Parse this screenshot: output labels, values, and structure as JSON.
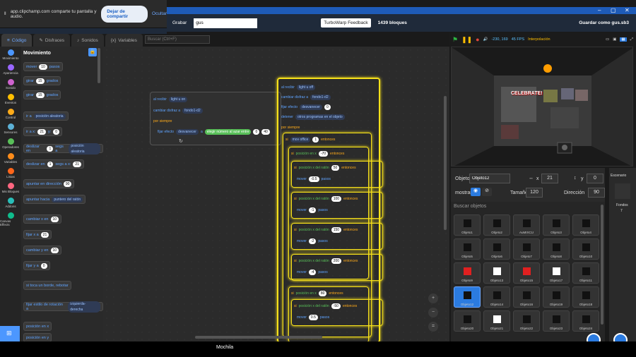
{
  "share": {
    "text": "app.clipchamp.com comparte tu pantalla y audio.",
    "stop": "Dejar de compartir",
    "hide": "Ocultar"
  },
  "menu": {
    "record": "Grabar",
    "project_name": "gus",
    "feedback": "TurboWarp Feedback",
    "blocks": "1439 bloques",
    "save": "Guardar como gus.sb3"
  },
  "tabs": [
    {
      "label": "Código"
    },
    {
      "label": "Disfraces"
    },
    {
      "label": "Sonidos"
    },
    {
      "label": "Variables"
    }
  ],
  "search_placeholder": "Buscar (Ctrl+F)",
  "categories": [
    {
      "label": "Movimiento",
      "color": "#4c97ff"
    },
    {
      "label": "Apariencia",
      "color": "#9966ff"
    },
    {
      "label": "Sonido",
      "color": "#cf63cf"
    },
    {
      "label": "Eventos",
      "color": "#ffbf00"
    },
    {
      "label": "Control",
      "color": "#ffab19"
    },
    {
      "label": "Sensores",
      "color": "#5cb1d6"
    },
    {
      "label": "Operadores",
      "color": "#59c059"
    },
    {
      "label": "Variables",
      "color": "#ff8c1a"
    },
    {
      "label": "Listas",
      "color": "#ff661a"
    },
    {
      "label": "Mis Bloques",
      "color": "#ff6680"
    },
    {
      "label": "Addons",
      "color": "#29beb8"
    },
    {
      "label": "Canvas Effects",
      "color": "#0fbd8c"
    }
  ],
  "palette": {
    "title": "Movimiento",
    "blocks": [
      {
        "t": "mover",
        "v": "10",
        "s": "pasos"
      },
      {
        "t": "girar",
        "v": "15",
        "s": "grados"
      },
      {
        "t": "girar",
        "v": "15",
        "s": "grados"
      },
      {
        "t": "ir a",
        "d": "posición aleatoria"
      },
      {
        "t": "ir a x:",
        "v": "21",
        "s": "y:",
        "v2": "0"
      },
      {
        "t": "deslizar en",
        "v": "1",
        "s": "segs a",
        "d": "posición aleatoria"
      },
      {
        "t": "deslizar en",
        "v": "1",
        "s": "segs a x:",
        "v2": "21"
      },
      {
        "t": "apuntar en dirección",
        "v": "90"
      },
      {
        "t": "apuntar hacia",
        "d": "puntero del ratón"
      },
      {
        "t": "cambiar x en",
        "v": "10"
      },
      {
        "t": "fijar x a",
        "v": "21"
      },
      {
        "t": "cambiar y en",
        "v": "10"
      },
      {
        "t": "fijar y a",
        "v": "0"
      },
      {
        "t": "si toca un borde, rebotar"
      },
      {
        "t": "fijar estilo de rotación a",
        "d": "izquierda-derecha"
      },
      {
        "t": "posición en x"
      },
      {
        "t": "posición en y"
      }
    ]
  },
  "script1": {
    "hat": "al recibir",
    "msg": "light u on",
    "b1": "cambiar disfraz a",
    "d1": "fondo1-d2",
    "loop": "por siempre",
    "b2": "fijar efecto",
    "d2": "desvanecer",
    "b2s": "a",
    "op": "elegir número al azar entre",
    "n1": "0",
    "n2": "40"
  },
  "script2": {
    "hat": "al recibir",
    "msg": "light u off",
    "b1": "cambiar disfraz a",
    "d1": "fondo1-d2",
    "b2": "fijar efecto",
    "d2": "desvanecer",
    "v2": "0",
    "b3": "detener",
    "d3": "otros programas en el objeto",
    "loop": "por siempre",
    "if1": "si",
    "c1": "mov office",
    "eq": "1",
    "then": "entonces",
    "c2": "posición en x",
    "v_lt": "-70",
    "rows": [
      {
        "c": "posición x del ratón",
        "v": "50",
        "m": "-0.5"
      },
      {
        "c": "posición x del ratón",
        "v": "100",
        "m": "-1"
      },
      {
        "c": "posición x del ratón",
        "v": "150",
        "m": "-2"
      },
      {
        "c": "posición x del ratón",
        "v": "200",
        "m": "-4"
      }
    ],
    "c3": "posición en x",
    "v3": "80",
    "c4": "posición x del ratón",
    "v4": "-50",
    "m4": "0.5",
    "move": "mover",
    "steps": "pasos"
  },
  "stage": {
    "fps": "45 FPS",
    "coords": "-230, 169",
    "interp": "Interpolación",
    "banner": "CELEBRATE!"
  },
  "sprite_info": {
    "label": "Objeto",
    "name": "Objeto12",
    "x": "21",
    "y": "0",
    "show": "mostrar",
    "size_label": "Tamaño",
    "size": "120",
    "dir_label": "Dirección",
    "dir": "90"
  },
  "search_sprites": "Buscar objetos",
  "sprites": [
    "Objeto1",
    "Objeto2",
    "AuMIXCU",
    "Objeto3",
    "Objeto4",
    "Objeto5",
    "Objeto6",
    "Objeto7",
    "Objeto8",
    "Objeto10",
    "Objeto9",
    "Objeto13",
    "Objeto15",
    "Objeto17",
    "Objeto11",
    "Objeto12",
    "Objeto14",
    "Objeto16",
    "Objeto19",
    "Objeto18",
    "Objeto20",
    "Objeto21",
    "Objeto22",
    "Objeto23",
    "Objeto24"
  ],
  "scene": {
    "label": "Escenario",
    "backdrops_label": "Fondos",
    "backdrops": "7"
  },
  "backpack": "Mochila"
}
